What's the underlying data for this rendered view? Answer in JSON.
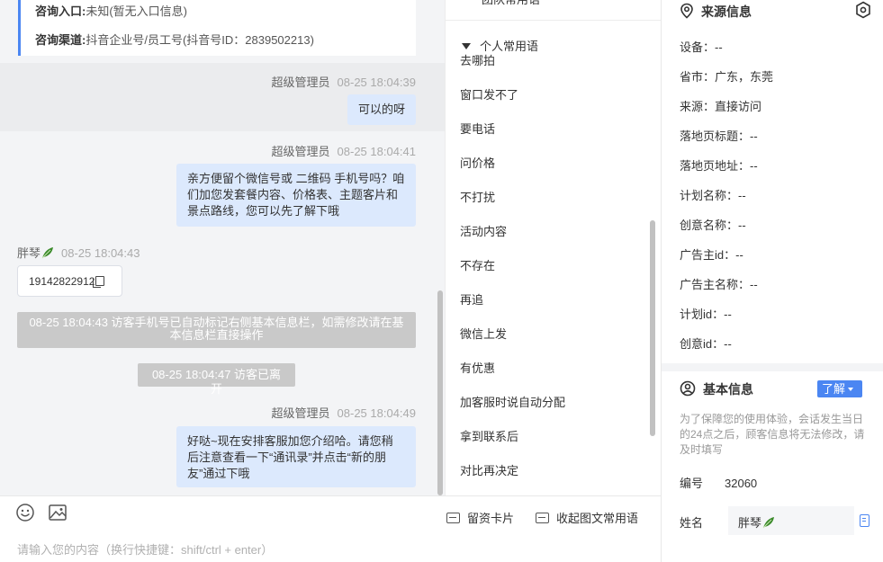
{
  "chat": {
    "info_card": {
      "entry_label": "咨询入口:",
      "entry_value": "未知(暂无入口信息)",
      "channel_label": "咨询渠道:",
      "channel_value": "抖音企业号/员工号(抖音号ID：2839502213)"
    },
    "messages": [
      {
        "sender": "超级管理员",
        "time": "08-25 18:04:39",
        "text": "可以的呀"
      },
      {
        "sender": "超级管理员",
        "time": "08-25 18:04:41",
        "lines": [
          "亲方便留个微信号或 二维码 手机号吗？咱",
          "们加您发套餐内容、价格表、主题客片和",
          "景点路线，您可以先了解下哦"
        ]
      },
      {
        "sender": "胖琴",
        "time": "08-25 18:04:43",
        "phone": "19142822912"
      },
      {
        "notice_lines": [
          "08-25 18:04:43 访客手机号已自动标记右侧基本信息栏，如需修改请在基",
          "本信息栏直接操作"
        ]
      },
      {
        "notice": "08-25 18:04:47 访客已离开"
      },
      {
        "sender": "超级管理员",
        "time": "08-25 18:04:49",
        "lines": [
          "好哒~现在安排客服加您介绍哈。请您稍",
          "后注意查看一下“通讯录”并点击“新的朋",
          "友”通过下哦"
        ]
      }
    ]
  },
  "input": {
    "leave_card_label": "留资卡片",
    "collapse_label": "收起图文常用语",
    "placeholder": "请输入您的内容（换行快捷键：shift/ctrl + enter）"
  },
  "phrases": {
    "top_label": "团队常用语",
    "header": "个人常用语",
    "items": [
      "去哪拍",
      "窗口发不了",
      "要电话",
      "问价格",
      "不打扰",
      "活动内容",
      "不存在",
      "再追",
      "微信上发",
      "有优惠",
      "加客服时说自动分配",
      "拿到联系后",
      "对比再决定"
    ]
  },
  "source": {
    "title": "来源信息",
    "fields": [
      {
        "label": "设备：",
        "value": "--"
      },
      {
        "label": "省市：",
        "value": "广东，东莞"
      },
      {
        "label": "来源：",
        "value": "直接访问"
      },
      {
        "label": "落地页标题：",
        "value": "--"
      },
      {
        "label": "落地页地址：",
        "value": "--"
      },
      {
        "label": "计划名称：",
        "value": "--"
      },
      {
        "label": "创意名称：",
        "value": "--"
      },
      {
        "label": "广告主id：",
        "value": "--"
      },
      {
        "label": "广告主名称：",
        "value": "--"
      },
      {
        "label": "计划id：",
        "value": "--"
      },
      {
        "label": "创意id：",
        "value": "--"
      }
    ]
  },
  "basic": {
    "title": "基本信息",
    "know_button": "了解",
    "hint": "为了保障您的使用体验，会话发生当日的24点之后，顾客信息将无法修改，请及时填写",
    "id_label": "编号",
    "id_value": "32060",
    "name_label": "姓名",
    "name_value": "胖琴"
  },
  "colors": {
    "accent": "#4b86f2",
    "bubble": "#dce9fd",
    "notice": "#c9c9c9",
    "leaf": "#3a8a2a"
  }
}
